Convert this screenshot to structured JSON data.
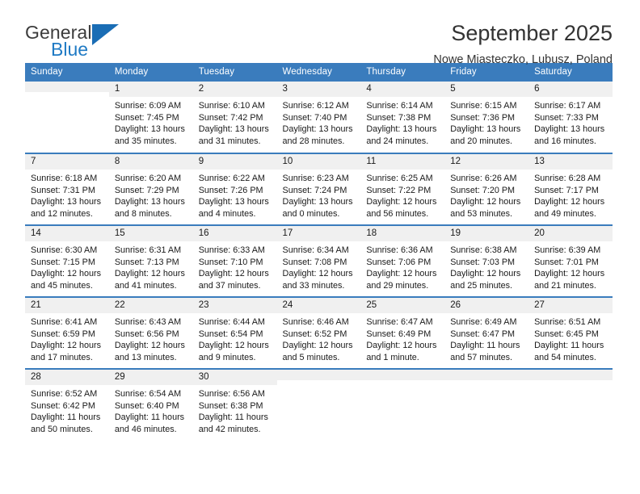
{
  "brand": {
    "name_top": "General",
    "name_bottom": "Blue",
    "accent_color": "#1a6db5"
  },
  "header": {
    "title": "September 2025",
    "subtitle": "Nowe Miasteczko, Lubusz, Poland"
  },
  "theme": {
    "header_bg": "#3a7cbd",
    "header_text": "#ffffff",
    "daynum_bg": "#f0f0f0",
    "cell_bg": "#ffffff",
    "text": "#1a1a1a"
  },
  "weekdays": [
    "Sunday",
    "Monday",
    "Tuesday",
    "Wednesday",
    "Thursday",
    "Friday",
    "Saturday"
  ],
  "labels": {
    "sunrise": "Sunrise:",
    "sunset": "Sunset:",
    "daylight": "Daylight:"
  },
  "weeks": [
    [
      {
        "day": "",
        "sunrise": "",
        "sunset": "",
        "daylight_line1": "",
        "daylight_line2": "",
        "blank": true
      },
      {
        "day": "1",
        "sunrise": "Sunrise: 6:09 AM",
        "sunset": "Sunset: 7:45 PM",
        "daylight_line1": "Daylight: 13 hours",
        "daylight_line2": "and 35 minutes."
      },
      {
        "day": "2",
        "sunrise": "Sunrise: 6:10 AM",
        "sunset": "Sunset: 7:42 PM",
        "daylight_line1": "Daylight: 13 hours",
        "daylight_line2": "and 31 minutes."
      },
      {
        "day": "3",
        "sunrise": "Sunrise: 6:12 AM",
        "sunset": "Sunset: 7:40 PM",
        "daylight_line1": "Daylight: 13 hours",
        "daylight_line2": "and 28 minutes."
      },
      {
        "day": "4",
        "sunrise": "Sunrise: 6:14 AM",
        "sunset": "Sunset: 7:38 PM",
        "daylight_line1": "Daylight: 13 hours",
        "daylight_line2": "and 24 minutes."
      },
      {
        "day": "5",
        "sunrise": "Sunrise: 6:15 AM",
        "sunset": "Sunset: 7:36 PM",
        "daylight_line1": "Daylight: 13 hours",
        "daylight_line2": "and 20 minutes."
      },
      {
        "day": "6",
        "sunrise": "Sunrise: 6:17 AM",
        "sunset": "Sunset: 7:33 PM",
        "daylight_line1": "Daylight: 13 hours",
        "daylight_line2": "and 16 minutes."
      }
    ],
    [
      {
        "day": "7",
        "sunrise": "Sunrise: 6:18 AM",
        "sunset": "Sunset: 7:31 PM",
        "daylight_line1": "Daylight: 13 hours",
        "daylight_line2": "and 12 minutes."
      },
      {
        "day": "8",
        "sunrise": "Sunrise: 6:20 AM",
        "sunset": "Sunset: 7:29 PM",
        "daylight_line1": "Daylight: 13 hours",
        "daylight_line2": "and 8 minutes."
      },
      {
        "day": "9",
        "sunrise": "Sunrise: 6:22 AM",
        "sunset": "Sunset: 7:26 PM",
        "daylight_line1": "Daylight: 13 hours",
        "daylight_line2": "and 4 minutes."
      },
      {
        "day": "10",
        "sunrise": "Sunrise: 6:23 AM",
        "sunset": "Sunset: 7:24 PM",
        "daylight_line1": "Daylight: 13 hours",
        "daylight_line2": "and 0 minutes."
      },
      {
        "day": "11",
        "sunrise": "Sunrise: 6:25 AM",
        "sunset": "Sunset: 7:22 PM",
        "daylight_line1": "Daylight: 12 hours",
        "daylight_line2": "and 56 minutes."
      },
      {
        "day": "12",
        "sunrise": "Sunrise: 6:26 AM",
        "sunset": "Sunset: 7:20 PM",
        "daylight_line1": "Daylight: 12 hours",
        "daylight_line2": "and 53 minutes."
      },
      {
        "day": "13",
        "sunrise": "Sunrise: 6:28 AM",
        "sunset": "Sunset: 7:17 PM",
        "daylight_line1": "Daylight: 12 hours",
        "daylight_line2": "and 49 minutes."
      }
    ],
    [
      {
        "day": "14",
        "sunrise": "Sunrise: 6:30 AM",
        "sunset": "Sunset: 7:15 PM",
        "daylight_line1": "Daylight: 12 hours",
        "daylight_line2": "and 45 minutes."
      },
      {
        "day": "15",
        "sunrise": "Sunrise: 6:31 AM",
        "sunset": "Sunset: 7:13 PM",
        "daylight_line1": "Daylight: 12 hours",
        "daylight_line2": "and 41 minutes."
      },
      {
        "day": "16",
        "sunrise": "Sunrise: 6:33 AM",
        "sunset": "Sunset: 7:10 PM",
        "daylight_line1": "Daylight: 12 hours",
        "daylight_line2": "and 37 minutes."
      },
      {
        "day": "17",
        "sunrise": "Sunrise: 6:34 AM",
        "sunset": "Sunset: 7:08 PM",
        "daylight_line1": "Daylight: 12 hours",
        "daylight_line2": "and 33 minutes."
      },
      {
        "day": "18",
        "sunrise": "Sunrise: 6:36 AM",
        "sunset": "Sunset: 7:06 PM",
        "daylight_line1": "Daylight: 12 hours",
        "daylight_line2": "and 29 minutes."
      },
      {
        "day": "19",
        "sunrise": "Sunrise: 6:38 AM",
        "sunset": "Sunset: 7:03 PM",
        "daylight_line1": "Daylight: 12 hours",
        "daylight_line2": "and 25 minutes."
      },
      {
        "day": "20",
        "sunrise": "Sunrise: 6:39 AM",
        "sunset": "Sunset: 7:01 PM",
        "daylight_line1": "Daylight: 12 hours",
        "daylight_line2": "and 21 minutes."
      }
    ],
    [
      {
        "day": "21",
        "sunrise": "Sunrise: 6:41 AM",
        "sunset": "Sunset: 6:59 PM",
        "daylight_line1": "Daylight: 12 hours",
        "daylight_line2": "and 17 minutes."
      },
      {
        "day": "22",
        "sunrise": "Sunrise: 6:43 AM",
        "sunset": "Sunset: 6:56 PM",
        "daylight_line1": "Daylight: 12 hours",
        "daylight_line2": "and 13 minutes."
      },
      {
        "day": "23",
        "sunrise": "Sunrise: 6:44 AM",
        "sunset": "Sunset: 6:54 PM",
        "daylight_line1": "Daylight: 12 hours",
        "daylight_line2": "and 9 minutes."
      },
      {
        "day": "24",
        "sunrise": "Sunrise: 6:46 AM",
        "sunset": "Sunset: 6:52 PM",
        "daylight_line1": "Daylight: 12 hours",
        "daylight_line2": "and 5 minutes."
      },
      {
        "day": "25",
        "sunrise": "Sunrise: 6:47 AM",
        "sunset": "Sunset: 6:49 PM",
        "daylight_line1": "Daylight: 12 hours",
        "daylight_line2": "and 1 minute."
      },
      {
        "day": "26",
        "sunrise": "Sunrise: 6:49 AM",
        "sunset": "Sunset: 6:47 PM",
        "daylight_line1": "Daylight: 11 hours",
        "daylight_line2": "and 57 minutes."
      },
      {
        "day": "27",
        "sunrise": "Sunrise: 6:51 AM",
        "sunset": "Sunset: 6:45 PM",
        "daylight_line1": "Daylight: 11 hours",
        "daylight_line2": "and 54 minutes."
      }
    ],
    [
      {
        "day": "28",
        "sunrise": "Sunrise: 6:52 AM",
        "sunset": "Sunset: 6:42 PM",
        "daylight_line1": "Daylight: 11 hours",
        "daylight_line2": "and 50 minutes."
      },
      {
        "day": "29",
        "sunrise": "Sunrise: 6:54 AM",
        "sunset": "Sunset: 6:40 PM",
        "daylight_line1": "Daylight: 11 hours",
        "daylight_line2": "and 46 minutes."
      },
      {
        "day": "30",
        "sunrise": "Sunrise: 6:56 AM",
        "sunset": "Sunset: 6:38 PM",
        "daylight_line1": "Daylight: 11 hours",
        "daylight_line2": "and 42 minutes."
      },
      {
        "day": "",
        "sunrise": "",
        "sunset": "",
        "daylight_line1": "",
        "daylight_line2": "",
        "blank": true
      },
      {
        "day": "",
        "sunrise": "",
        "sunset": "",
        "daylight_line1": "",
        "daylight_line2": "",
        "blank": true
      },
      {
        "day": "",
        "sunrise": "",
        "sunset": "",
        "daylight_line1": "",
        "daylight_line2": "",
        "blank": true
      },
      {
        "day": "",
        "sunrise": "",
        "sunset": "",
        "daylight_line1": "",
        "daylight_line2": "",
        "blank": true
      }
    ]
  ]
}
